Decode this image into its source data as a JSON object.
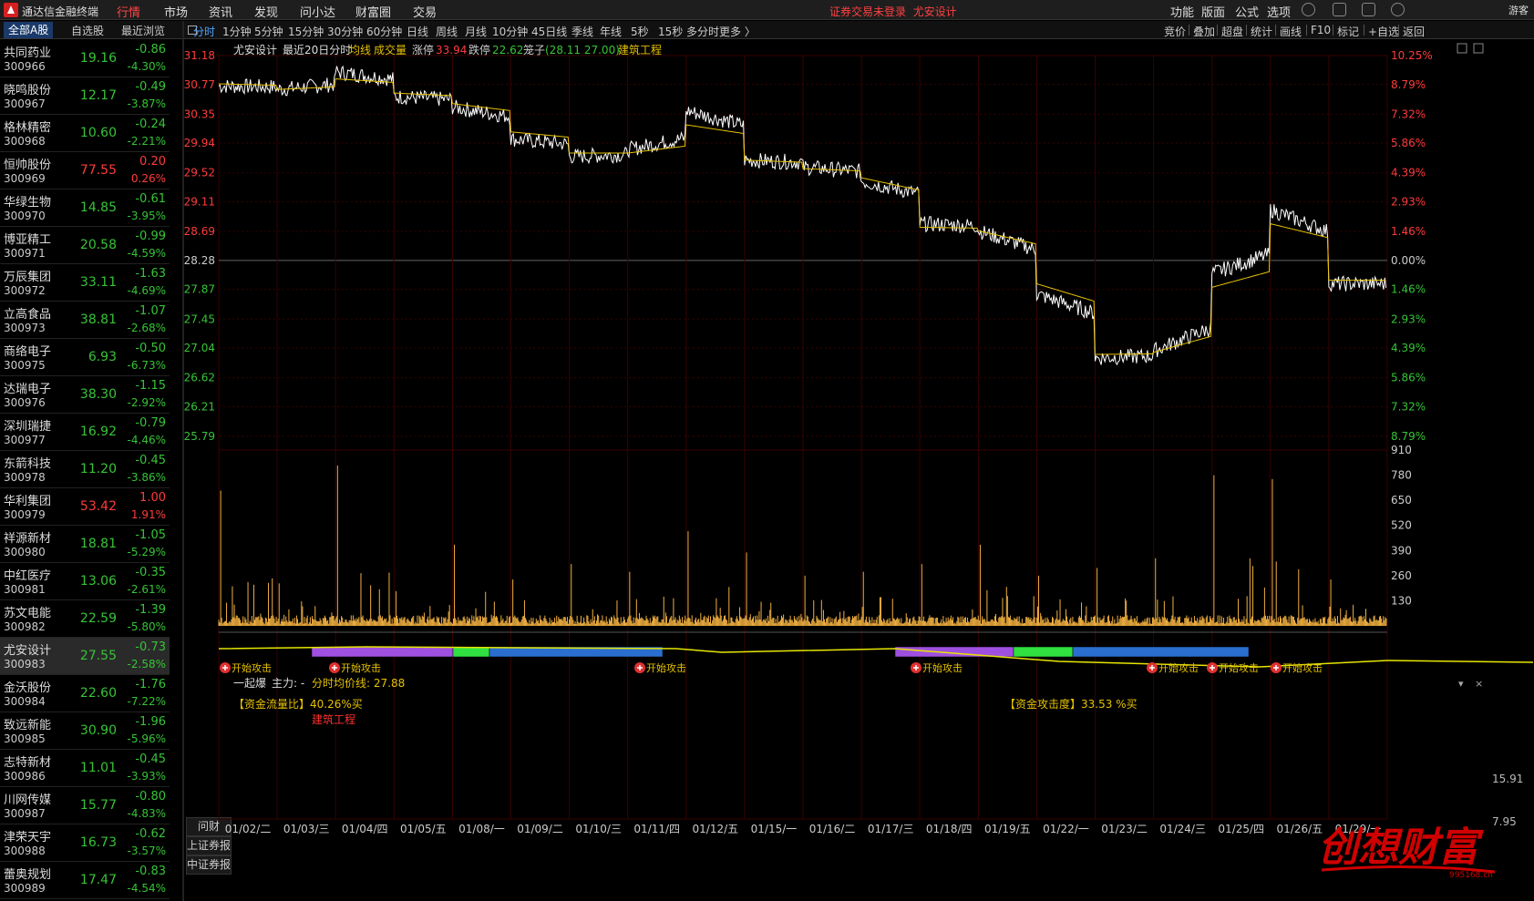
{
  "app": {
    "title": "通达信金融终端"
  },
  "menu": [
    "行情",
    "市场",
    "资讯",
    "发现",
    "问小达",
    "财富圈",
    "交易"
  ],
  "top_notice": [
    "证券交易未登录",
    "尤安设计"
  ],
  "top_right": [
    "功能",
    "版面",
    "公式",
    "选项",
    "游客"
  ],
  "left_tabs": [
    "全部A股",
    "自选股",
    "最近浏览"
  ],
  "stocks": [
    {
      "name": "共同药业",
      "code": "300966",
      "price": "19.16",
      "change": "-0.86",
      "pct": "-4.30%",
      "dir": "down"
    },
    {
      "name": "晓鸣股份",
      "code": "300967",
      "price": "12.17",
      "change": "-0.49",
      "pct": "-3.87%",
      "dir": "down"
    },
    {
      "name": "格林精密",
      "code": "300968",
      "price": "10.60",
      "change": "-0.24",
      "pct": "-2.21%",
      "dir": "down"
    },
    {
      "name": "恒帅股份",
      "code": "300969",
      "price": "77.55",
      "change": "0.20",
      "pct": "0.26%",
      "dir": "up"
    },
    {
      "name": "华绿生物",
      "code": "300970",
      "price": "14.85",
      "change": "-0.61",
      "pct": "-3.95%",
      "dir": "down"
    },
    {
      "name": "博亚精工",
      "code": "300971",
      "price": "20.58",
      "change": "-0.99",
      "pct": "-4.59%",
      "dir": "down"
    },
    {
      "name": "万辰集团",
      "code": "300972",
      "price": "33.11",
      "change": "-1.63",
      "pct": "-4.69%",
      "dir": "down"
    },
    {
      "name": "立高食品",
      "code": "300973",
      "price": "38.81",
      "change": "-1.07",
      "pct": "-2.68%",
      "dir": "down"
    },
    {
      "name": "商络电子",
      "code": "300975",
      "price": "6.93",
      "change": "-0.50",
      "pct": "-6.73%",
      "dir": "down"
    },
    {
      "name": "达瑞电子",
      "code": "300976",
      "price": "38.30",
      "change": "-1.15",
      "pct": "-2.92%",
      "dir": "down"
    },
    {
      "name": "深圳瑞捷",
      "code": "300977",
      "price": "16.92",
      "change": "-0.79",
      "pct": "-4.46%",
      "dir": "down"
    },
    {
      "name": "东箭科技",
      "code": "300978",
      "price": "11.20",
      "change": "-0.45",
      "pct": "-3.86%",
      "dir": "down"
    },
    {
      "name": "华利集团",
      "code": "300979",
      "price": "53.42",
      "change": "1.00",
      "pct": "1.91%",
      "dir": "up"
    },
    {
      "name": "祥源新材",
      "code": "300980",
      "price": "18.81",
      "change": "-1.05",
      "pct": "-5.29%",
      "dir": "down"
    },
    {
      "name": "中红医疗",
      "code": "300981",
      "price": "13.06",
      "change": "-0.35",
      "pct": "-2.61%",
      "dir": "down"
    },
    {
      "name": "苏文电能",
      "code": "300982",
      "price": "22.59",
      "change": "-1.39",
      "pct": "-5.80%",
      "dir": "down"
    },
    {
      "name": "尤安设计",
      "code": "300983",
      "price": "27.55",
      "change": "-0.73",
      "pct": "-2.58%",
      "dir": "down"
    },
    {
      "name": "金沃股份",
      "code": "300984",
      "price": "22.60",
      "change": "-1.76",
      "pct": "-7.22%",
      "dir": "down"
    },
    {
      "name": "致远新能",
      "code": "300985",
      "price": "30.90",
      "change": "-1.96",
      "pct": "-5.96%",
      "dir": "down"
    },
    {
      "name": "志特新材",
      "code": "300986",
      "price": "11.01",
      "change": "-0.45",
      "pct": "-3.93%",
      "dir": "down"
    },
    {
      "name": "川网传媒",
      "code": "300987",
      "price": "15.77",
      "change": "-0.80",
      "pct": "-4.83%",
      "dir": "down"
    },
    {
      "name": "津荣天宇",
      "code": "300988",
      "price": "16.73",
      "change": "-0.62",
      "pct": "-3.57%",
      "dir": "down"
    },
    {
      "name": "蕾奥规划",
      "code": "300989",
      "price": "17.47",
      "change": "-0.83",
      "pct": "-4.54%",
      "dir": "down"
    }
  ],
  "selected_stock": "尤安设计",
  "periods": [
    "分时",
    "1分钟",
    "5分钟",
    "15分钟",
    "30分钟",
    "60分钟",
    "日线",
    "周线",
    "月线",
    "10分钟",
    "45日线",
    "季线",
    "年线",
    "5秒",
    "15秒",
    "多分时",
    "更多 〉"
  ],
  "chart_tools": [
    "竞价",
    "叠加",
    "超盘",
    "统计",
    "画线",
    "F10",
    "标记",
    "+自选",
    "返回"
  ],
  "side_buttons": [
    "问财",
    "上证券报",
    "中证券报"
  ],
  "info_bar": {
    "stock": "尤安设计",
    "label": "最近20日分时",
    "avg_label": "均线",
    "vol_label": "成交量",
    "limit_up_label": "涨停",
    "limit_up": "33.94",
    "limit_down_label": "跌停",
    "limit_down": "22.62",
    "cage_label": "笼子",
    "cage": "(28.11 27.00)",
    "sector": "建筑工程"
  },
  "indicator": {
    "name": "一起爆",
    "main_label": "主力: -",
    "avg_label": "分时均价线: 27.88",
    "flow_label": "【资金流量比】40.26%买",
    "attack_label": "【资金攻击度】33.53 %买",
    "signal_label": "开始攻击",
    "extra_label": "建筑工程",
    "right_labels": [
      "15.91",
      "7.95"
    ]
  },
  "watermark": {
    "text": "创想财富",
    "url": "995168.cn"
  },
  "colors": {
    "up": "#ff3b3b",
    "down": "#36c436",
    "price_line": "#ffffff",
    "avg_line": "#e6c200",
    "volume": "#f0b040",
    "grid": "#3a0000",
    "watermark": "#d00000"
  },
  "chart_data": {
    "type": "line",
    "ylim": [
      25.79,
      31.18
    ],
    "ylabels_left": [
      "31.18",
      "30.77",
      "30.35",
      "29.94",
      "29.52",
      "29.11",
      "28.69",
      "28.28",
      "27.87",
      "27.45",
      "27.04",
      "26.62",
      "26.21",
      "25.79"
    ],
    "ylabels_right": [
      "10.25%",
      "8.79%",
      "7.32%",
      "5.86%",
      "4.39%",
      "2.93%",
      "1.46%",
      "0.00%",
      "1.46%",
      "2.93%",
      "4.39%",
      "5.86%",
      "7.32%",
      "8.79%"
    ],
    "base_price": 28.28,
    "categories": [
      "01/02/二",
      "01/03/三",
      "01/04/四",
      "01/05/五",
      "01/08/一",
      "01/09/二",
      "01/10/三",
      "01/11/四",
      "01/12/五",
      "01/15/一",
      "01/16/二",
      "01/17/三",
      "01/18/四",
      "01/19/五",
      "01/22/一",
      "01/23/二",
      "01/24/三",
      "01/25/四",
      "01/26/五",
      "01/29/一"
    ],
    "series": [
      {
        "name": "价格",
        "values": [
          30.75,
          30.7,
          30.95,
          30.6,
          30.45,
          30.0,
          29.75,
          29.85,
          30.4,
          29.7,
          29.6,
          29.4,
          28.8,
          28.7,
          27.8,
          26.9,
          27.0,
          28.1,
          29.0,
          27.95
        ]
      },
      {
        "name": "均线",
        "values": [
          30.78,
          30.7,
          30.85,
          30.65,
          30.5,
          30.1,
          29.8,
          29.8,
          30.2,
          29.7,
          29.58,
          29.45,
          28.75,
          28.7,
          27.95,
          26.95,
          26.98,
          27.9,
          28.8,
          28.0
        ]
      }
    ],
    "volume_ylabels": [
      "910",
      "780",
      "650",
      "520",
      "390",
      "260",
      "130"
    ],
    "volume_ylim": [
      0,
      910
    ],
    "volume_peaks": [
      700,
      220,
      830,
      180,
      420,
      240,
      320,
      280,
      490,
      380,
      260,
      280,
      320,
      420,
      260,
      300,
      350,
      780,
      760,
      240
    ]
  }
}
